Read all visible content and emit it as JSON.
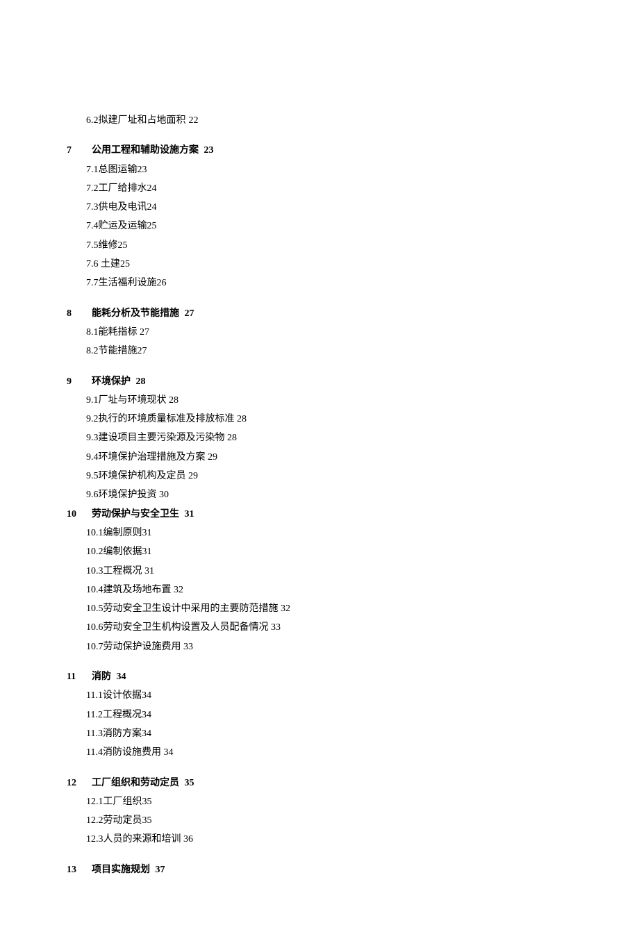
{
  "orphan": {
    "num": "6.2",
    "title": "拟建厂址和占地面积",
    "page": "22"
  },
  "sections": [
    {
      "chapter_num": "7",
      "chapter_title": "公用工程和辅助设施方案",
      "chapter_page": "23",
      "subs": [
        {
          "num": "7.1",
          "title": "总图运输",
          "page": "23"
        },
        {
          "num": "7.2",
          "title": "工厂给排水",
          "page": "24"
        },
        {
          "num": "7.3",
          "title": "供电及电讯",
          "page": "24"
        },
        {
          "num": "7.4",
          "title": "贮运及运输",
          "page": "25"
        },
        {
          "num": "7.5",
          "title": "维修",
          "page": "25"
        },
        {
          "num": "7.6",
          "title": " 土建",
          "page": "25"
        },
        {
          "num": "7.7",
          "title": "生活福利设施",
          "page": "26"
        }
      ]
    },
    {
      "chapter_num": "8",
      "chapter_title": "能耗分析及节能措施",
      "chapter_page": "27",
      "subs": [
        {
          "num": "8.1",
          "title": "能耗指标",
          "page": " 27"
        },
        {
          "num": "8.2",
          "title": "节能措施",
          "page": "27"
        }
      ]
    },
    {
      "chapter_num": "9",
      "chapter_title": "环境保护",
      "chapter_page": "28",
      "subs": [
        {
          "num": "9.1",
          "title": "厂址与环境现状",
          "page": " 28"
        },
        {
          "num": "9.2",
          "title": "执行的环境质量标准及排放标准",
          "page": " 28"
        },
        {
          "num": "9.3",
          "title": "建设项目主要污染源及污染物",
          "page": " 28"
        },
        {
          "num": "9.4",
          "title": "环境保护治理措施及方案",
          "page": " 29"
        },
        {
          "num": "9.5",
          "title": "环境保护机构及定员",
          "page": " 29"
        },
        {
          "num": "9.6",
          "title": "环境保护投资",
          "page": " 30"
        }
      ]
    },
    {
      "chapter_num": "10",
      "chapter_title": "劳动保护与安全卫生",
      "chapter_page": "31",
      "no_gap_before": true,
      "subs": [
        {
          "num": "10.1",
          "title": "编制原则",
          "page": "31"
        },
        {
          "num": "10.2",
          "title": "编制依据",
          "page": "31"
        },
        {
          "num": "10.3",
          "title": "工程概况",
          "page": " 31"
        },
        {
          "num": "10.4",
          "title": "建筑及场地布置",
          "page": " 32"
        },
        {
          "num": "10.5",
          "title": "劳动安全卫生设计中采用的主要防范措施",
          "page": " 32"
        },
        {
          "num": "10.6",
          "title": "劳动安全卫生机构设置及人员配备情况",
          "page": " 33"
        },
        {
          "num": "10.7",
          "title": "劳动保护设施费用",
          "page": " 33"
        }
      ]
    },
    {
      "chapter_num": "11",
      "chapter_title": "消防",
      "chapter_page": "34",
      "subs": [
        {
          "num": "11.1",
          "title": "设计依据",
          "page": "34"
        },
        {
          "num": "11.2",
          "title": "工程概况",
          "page": "34"
        },
        {
          "num": "11.3",
          "title": "消防方案",
          "page": "34"
        },
        {
          "num": "11.4",
          "title": "消防设施费用",
          "page": " 34"
        }
      ]
    },
    {
      "chapter_num": "12",
      "chapter_title": "工厂组织和劳动定员",
      "chapter_page": "35",
      "subs": [
        {
          "num": "12.1",
          "title": "工厂组织",
          "page": "35"
        },
        {
          "num": "12.2",
          "title": "劳动定员",
          "page": "35"
        },
        {
          "num": "12.3",
          "title": "人员的来源和培训",
          "page": " 36"
        }
      ]
    },
    {
      "chapter_num": "13",
      "chapter_title": "项目实施规划",
      "chapter_page": "37",
      "subs": []
    }
  ]
}
